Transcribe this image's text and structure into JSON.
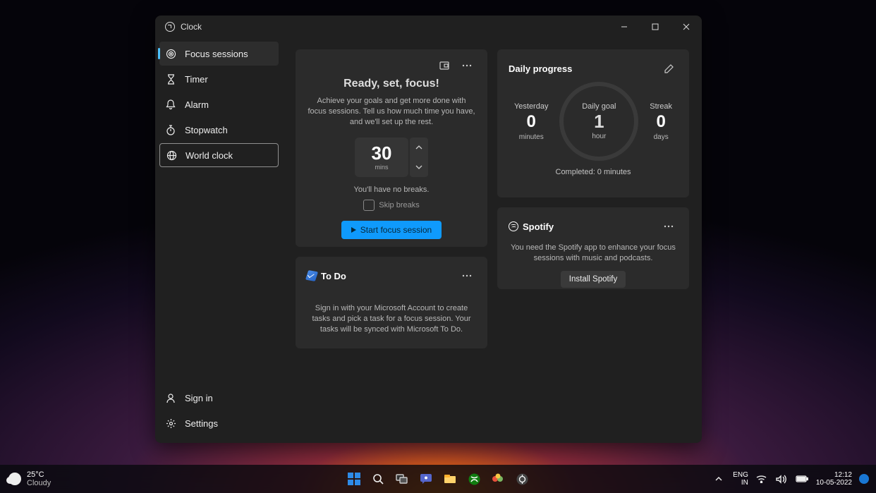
{
  "window": {
    "title": "Clock",
    "sidebar": {
      "items": [
        {
          "label": "Focus sessions"
        },
        {
          "label": "Timer"
        },
        {
          "label": "Alarm"
        },
        {
          "label": "Stopwatch"
        },
        {
          "label": "World clock"
        }
      ],
      "sign_in": "Sign in",
      "settings": "Settings"
    },
    "focus": {
      "title": "Ready, set, focus!",
      "desc": "Achieve your goals and get more done with focus sessions. Tell us how much time you have, and we'll set up the rest.",
      "minutes": "30",
      "minutes_unit": "mins",
      "breaks_text": "You'll have no breaks.",
      "skip_label": "Skip breaks",
      "start_label": "Start focus session"
    },
    "todo": {
      "title": "To Do",
      "desc": "Sign in with your Microsoft Account to create tasks and pick a task for a focus session. Your tasks will be synced with Microsoft To Do."
    },
    "progress": {
      "title": "Daily progress",
      "yesterday_label": "Yesterday",
      "yesterday_value": "0",
      "yesterday_unit": "minutes",
      "goal_label": "Daily goal",
      "goal_value": "1",
      "goal_unit": "hour",
      "streak_label": "Streak",
      "streak_value": "0",
      "streak_unit": "days",
      "completed": "Completed: 0 minutes"
    },
    "spotify": {
      "title": "Spotify",
      "desc": "You need the Spotify app to enhance your focus sessions with music and podcasts.",
      "install": "Install Spotify"
    }
  },
  "taskbar": {
    "weather_temp": "25°C",
    "weather_desc": "Cloudy",
    "lang1": "ENG",
    "lang2": "IN",
    "time": "12:12",
    "date": "10-05-2022"
  }
}
